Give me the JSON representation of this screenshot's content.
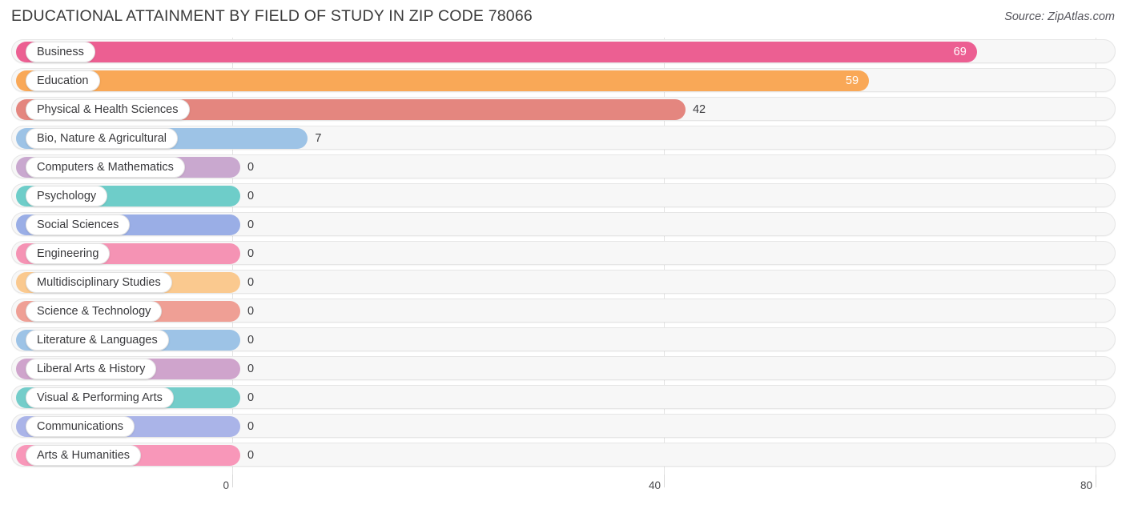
{
  "header": {
    "title": "EDUCATIONAL ATTAINMENT BY FIELD OF STUDY IN ZIP CODE 78066",
    "source": "Source: ZipAtlas.com"
  },
  "chart_data": {
    "type": "bar",
    "orientation": "horizontal",
    "title": "EDUCATIONAL ATTAINMENT BY FIELD OF STUDY IN ZIP CODE 78066",
    "xlabel": "",
    "ylabel": "",
    "xlim": [
      0,
      80
    ],
    "xticks": [
      "0",
      "40",
      "80"
    ],
    "xtick_values": [
      0,
      40,
      80
    ],
    "grid": true,
    "legend": false,
    "categories": [
      "Business",
      "Education",
      "Physical & Health Sciences",
      "Bio, Nature & Agricultural",
      "Computers & Mathematics",
      "Psychology",
      "Social Sciences",
      "Engineering",
      "Multidisciplinary Studies",
      "Science & Technology",
      "Literature & Languages",
      "Liberal Arts & History",
      "Visual & Performing Arts",
      "Communications",
      "Arts & Humanities"
    ],
    "values": [
      69,
      59,
      42,
      7,
      0,
      0,
      0,
      0,
      0,
      0,
      0,
      0,
      0,
      0,
      0
    ],
    "value_labels": [
      "69",
      "59",
      "42",
      "7",
      "0",
      "0",
      "0",
      "0",
      "0",
      "0",
      "0",
      "0",
      "0",
      "0",
      "0"
    ],
    "colors": [
      "#ec5f92",
      "#f9a857",
      "#e4867f",
      "#9dc3e6",
      "#c9a8cf",
      "#6ecdc9",
      "#9aaee6",
      "#f593b4",
      "#fac98f",
      "#ef9f95",
      "#9dc3e6",
      "#cfa4cc",
      "#74cdca",
      "#aab4e8",
      "#f897b9"
    ],
    "label_position": [
      "inside",
      "inside",
      "outside",
      "outside",
      "outside",
      "outside",
      "outside",
      "outside",
      "outside",
      "outside",
      "outside",
      "outside",
      "outside",
      "outside",
      "outside"
    ]
  },
  "axis": {
    "ticks": [
      {
        "label": "0",
        "value": 0
      },
      {
        "label": "40",
        "value": 40
      },
      {
        "label": "80",
        "value": 80
      }
    ]
  }
}
